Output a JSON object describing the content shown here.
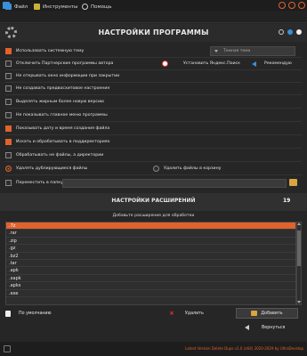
{
  "menu": {
    "file": "Файл",
    "tools": "Инструменты",
    "help": "Помощь"
  },
  "header": {
    "title": "НАСТРОЙКИ ПРОГРАММЫ"
  },
  "settings": {
    "use_system_theme": {
      "label": "Использовать системную тему",
      "checked": true
    },
    "theme_select": "Темная тема",
    "disable_partner": {
      "label": "Отключить Партнерские программы автора",
      "checked": false
    },
    "install_yandex": "Установить Яндекс.Поиск",
    "recommend": "Рекомендую",
    "no_info_window": {
      "label": "Не открывать окно информации при закрытии",
      "checked": false
    },
    "no_restore_point": {
      "label": "Не создавать предвосхитовое настроение",
      "checked": false
    },
    "bold_newer": {
      "label": "Выделять жирным более новую версию",
      "checked": false
    },
    "hide_main_menu": {
      "label": "Не показывать главное меню программы",
      "checked": false
    },
    "show_date": {
      "label": "Показывать дату и время создания файла",
      "checked": true
    },
    "search_subdirs": {
      "label": "Искать и обрабатывать в поддиректориях",
      "checked": true
    },
    "process_files_dirs": {
      "label": "Обрабатывать не файлы, а директории",
      "checked": false
    },
    "delete_duplicates": {
      "label": "Удалять дублирующиеся файлы",
      "selected": true
    },
    "delete_to_trash": {
      "label": "Удалить файлы в корзину",
      "checked": false
    },
    "move_to_folder": {
      "label": "Переместить в папку",
      "checked": false,
      "value": ""
    }
  },
  "extensions": {
    "title": "НАСТРОЙКИ РАСШИРЕНИЙ",
    "count": "19",
    "subtitle": "Добавьте расширение для обработки",
    "items": [
      ".7z",
      ".rar",
      ".zip",
      ".gz",
      ".bz2",
      ".tar",
      ".apk",
      ".xapk",
      ".apks",
      ".exe"
    ],
    "selected_index": 0
  },
  "actions": {
    "default_label": "По умолчанию",
    "delete_label": "Удалить",
    "add_label": "Добавить",
    "return_label": "Вернуться"
  },
  "footer": {
    "text": "Latest Version Delete Dups v1.0 (x64) 2020-2029 by UltraDevelop"
  },
  "colors": {
    "accent": "#e0622d",
    "bg": "#262626"
  }
}
